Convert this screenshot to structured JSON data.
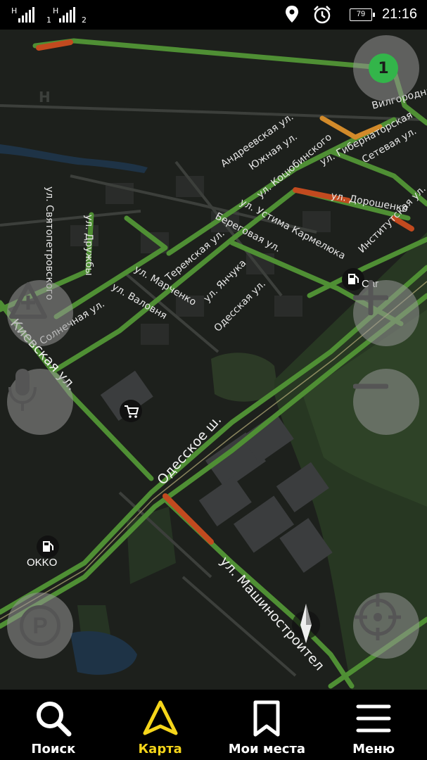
{
  "status_bar": {
    "sim1_network": "H",
    "sim1_index": "1",
    "sim2_network": "H",
    "sim2_index": "2",
    "battery": "79",
    "time": "21:16",
    "icons": [
      "location-icon",
      "alarm-icon",
      "battery-icon"
    ]
  },
  "map": {
    "traffic_level": "1",
    "traffic_color": "#33b54a",
    "streets": {
      "andreevskaya": "Андреевская ул.",
      "yuzhnaya": "Южная ул.",
      "kotsyubinskogo": "ул. Коцюбинского",
      "gubernatorskaya": "ул. Гибернаторская",
      "setevaya": "Сетевая ул.",
      "doroshenko": "ул. Дорошенко",
      "svyatopetrovskogo": "ул. Святопетровского",
      "druzhby": "ул. Дружбы",
      "ustima": "ул. Устима Кармелюка",
      "beregovaya": "Береговая ул.",
      "institutskaya": "Институтская ул.",
      "teremskaya": "Теремская ул.",
      "marchenko": "ул. Марченко",
      "yanchuka": "ул. Янчука",
      "odesskaya": "Одесская ул.",
      "valovnya": "ул. Валовня",
      "solnechnaya": "Солнечная ул.",
      "kievskaya": "Киевская ул.",
      "odesskoe_sh": "Одесское ш.",
      "mashinostroitel": "ул. Машиностроител",
      "vilgorodnaya": "Вилгородная ул."
    },
    "poi": {
      "gas_station_1": "OKKO",
      "gas_station_2": "Car"
    }
  },
  "map_controls": {
    "traffic_button": "traffic-level-button",
    "route_button": "route-triangle-icon",
    "voice_button": "microphone-icon",
    "parking_button": "P",
    "zoom_in": "+",
    "zoom_out": "−",
    "locate": "locate-icon"
  },
  "bottom_nav": {
    "search": "Поиск",
    "map": "Карта",
    "my_places": "Мои места",
    "menu": "Меню",
    "accent_color": "#f5d51a"
  }
}
